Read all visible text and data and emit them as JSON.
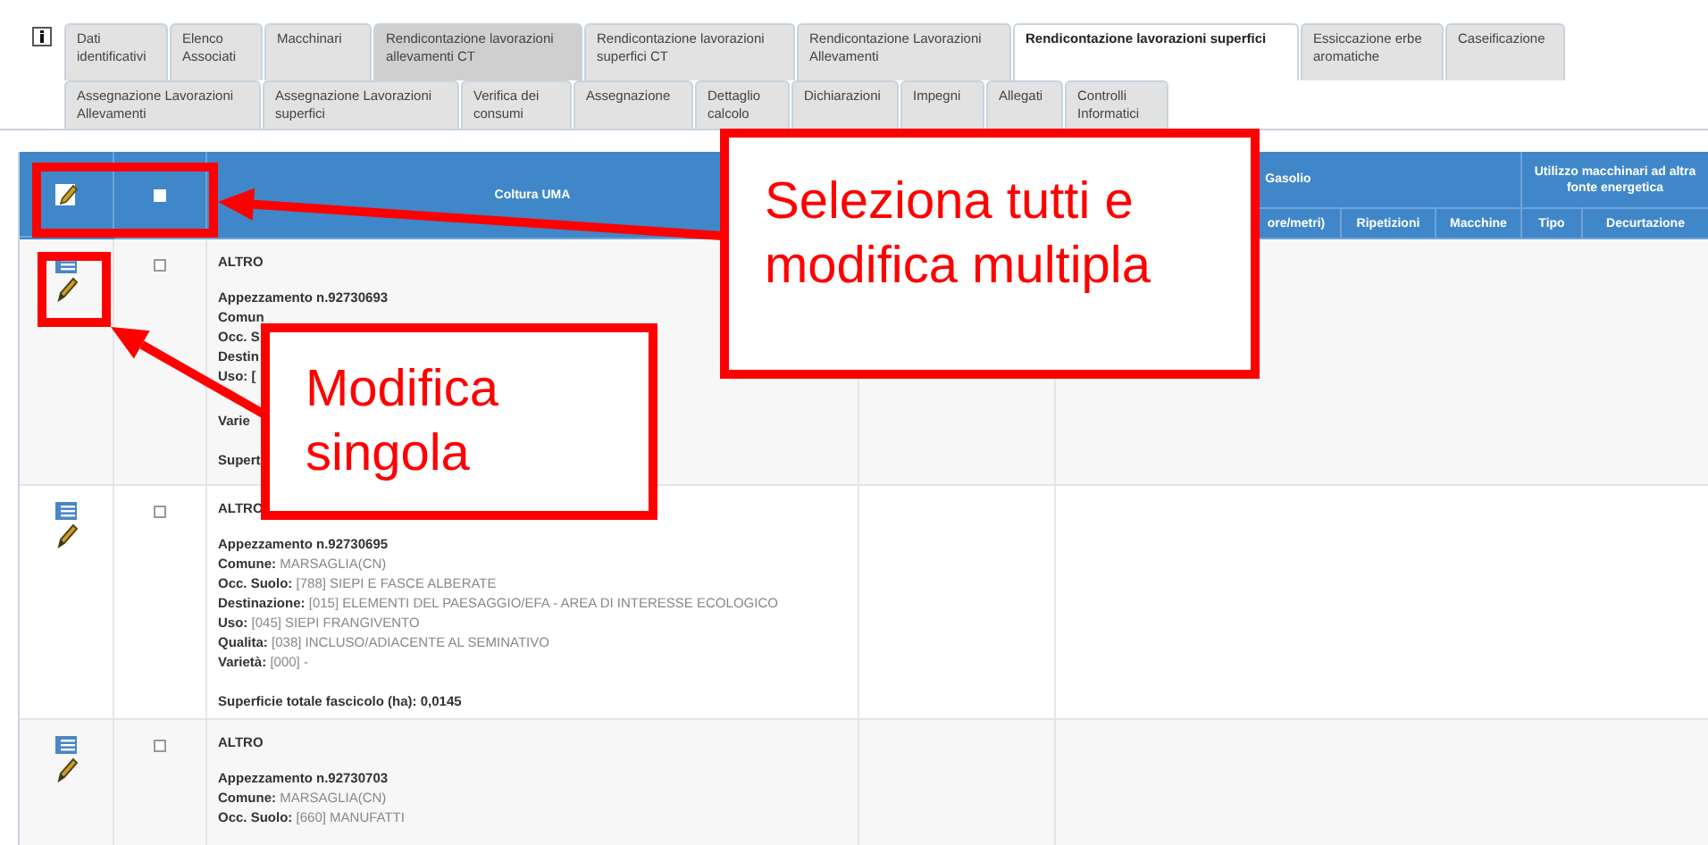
{
  "tabs_row_1": [
    {
      "label": "Dati identificativi",
      "selected": false,
      "highlighted": false
    },
    {
      "label": "Elenco Associati",
      "selected": false,
      "highlighted": false
    },
    {
      "label": "Macchinari",
      "selected": false,
      "highlighted": false
    },
    {
      "label": "Rendicontazione lavorazioni allevamenti CT",
      "selected": false,
      "highlighted": true
    },
    {
      "label": "Rendicontazione lavorazioni superfici CT",
      "selected": false,
      "highlighted": false
    },
    {
      "label": "Rendicontazione Lavorazioni Allevamenti",
      "selected": false,
      "highlighted": false
    },
    {
      "label": "Rendicontazione lavorazioni superfici",
      "selected": true,
      "highlighted": false
    },
    {
      "label": "Essiccazione erbe aromatiche",
      "selected": false,
      "highlighted": false
    },
    {
      "label": "Caseificazione",
      "selected": false,
      "highlighted": false
    }
  ],
  "tabs_row_2": [
    {
      "label": "Assegnazione Lavorazioni Allevamenti",
      "selected": false
    },
    {
      "label": "Assegnazione Lavorazioni superfici",
      "selected": false
    },
    {
      "label": "Verifica dei consumi",
      "selected": false
    },
    {
      "label": "Assegnazione",
      "selected": false
    },
    {
      "label": "Dettaglio calcolo",
      "selected": false
    },
    {
      "label": "Dichiarazioni",
      "selected": false
    },
    {
      "label": "Impegni",
      "selected": false
    },
    {
      "label": "Allegati",
      "selected": false
    },
    {
      "label": "Controlli Informatici",
      "selected": false
    }
  ],
  "table": {
    "select_all": {
      "checked": false
    },
    "columns": {
      "coltura": "Coltura UMA",
      "gasolio": "Gasolio",
      "utilizzo": "Utilizzo macchinari ad altra fonte energetica",
      "sub": [
        "ore/metri)",
        "Ripetizioni",
        "Macchine",
        "Tipo",
        "Decurtazione"
      ]
    },
    "rows": [
      {
        "checked": false,
        "title": "ALTRO",
        "parcel": "Appezzamento n.92730693",
        "details": [
          {
            "label": "Comun"
          },
          {
            "label": "Occ. S"
          },
          {
            "label": "Destin"
          },
          {
            "label": "Uso: ["
          },
          {
            "label": "Varie"
          }
        ],
        "total": {
          "label": "Supert"
        }
      },
      {
        "checked": false,
        "title": "ALTRO",
        "parcel": "Appezzamento n.92730695",
        "details": [
          {
            "label": "Comune:",
            "value": "MARSAGLIA(CN)"
          },
          {
            "label": "Occ. Suolo:",
            "value": "[788] SIEPI E FASCE ALBERATE"
          },
          {
            "label": "Destinazione:",
            "value": "[015] ELEMENTI DEL PAESAGGIO/EFA - AREA DI INTERESSE ECOLOGICO"
          },
          {
            "label": "Uso:",
            "value": "[045] SIEPI FRANGIVENTO"
          },
          {
            "label": "Qualita:",
            "value": "[038] INCLUSO/ADIACENTE AL SEMINATIVO"
          },
          {
            "label": "Varietà:",
            "value": "[000] -"
          }
        ],
        "total": {
          "label": "Superficie totale fascicolo (ha):",
          "value": "0,0145"
        }
      },
      {
        "checked": false,
        "title": "ALTRO",
        "parcel": "Appezzamento n.92730703",
        "details": [
          {
            "label": "Comune:",
            "value": "MARSAGLIA(CN)"
          },
          {
            "label": "Occ. Suolo:",
            "value": "[660] MANUFATTI"
          }
        ]
      }
    ]
  },
  "annotations": [
    {
      "text": "Seleziona tutti e modifica multipla"
    },
    {
      "text": "Modifica singola"
    }
  ]
}
